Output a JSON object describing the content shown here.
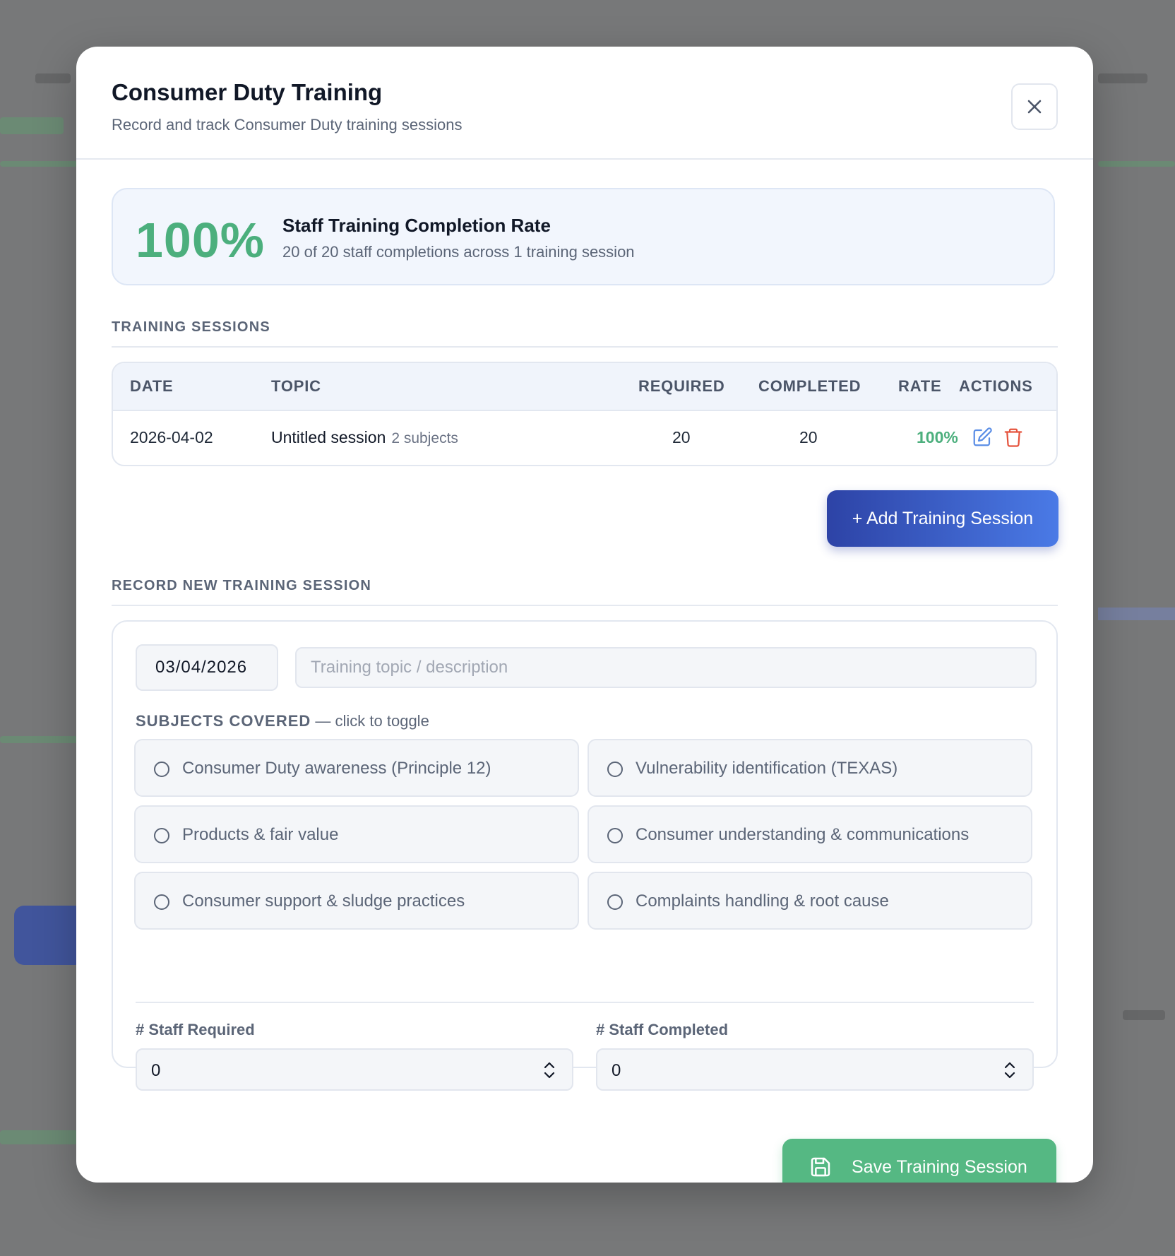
{
  "modal": {
    "title": "Consumer Duty Training",
    "subtitle": "Record and track Consumer Duty training sessions"
  },
  "summary": {
    "rate": "100%",
    "title": "Staff Training Completion Rate",
    "description": "20 of 20 staff completions across 1 training session"
  },
  "sessions": {
    "section_label": "TRAINING SESSIONS",
    "columns": [
      "DATE",
      "TOPIC",
      "REQUIRED",
      "COMPLETED",
      "RATE",
      "ACTIONS"
    ],
    "rows": [
      {
        "date": "2026-04-02",
        "topic": "Untitled session",
        "subjects": "2 subjects",
        "required": "20",
        "completed": "20",
        "rate": "100%"
      }
    ],
    "add_label": "+ Add Training Session"
  },
  "form": {
    "section_label": "RECORD NEW TRAINING SESSION",
    "date_value": "03/04/2026",
    "topic_placeholder": "Training topic / description",
    "subjects_label": "SUBJECTS COVERED",
    "subjects_hint": "— click to toggle",
    "subjects": [
      "Consumer Duty awareness (Principle 12)",
      "Vulnerability identification (TEXAS)",
      "Products & fair value",
      "Consumer understanding & communications",
      "Consumer support & sludge practices",
      "Complaints handling & root cause"
    ],
    "staff_required_label": "# Staff Required",
    "staff_required_value": "0",
    "staff_completed_label": "# Staff Completed",
    "staff_completed_value": "0",
    "save_label": "Save Training Session"
  },
  "colors": {
    "accent_green": "#4caf7d",
    "button_blue": "#2d43a6",
    "edit_icon": "#5b8ee6",
    "delete_icon": "#e5533d"
  }
}
